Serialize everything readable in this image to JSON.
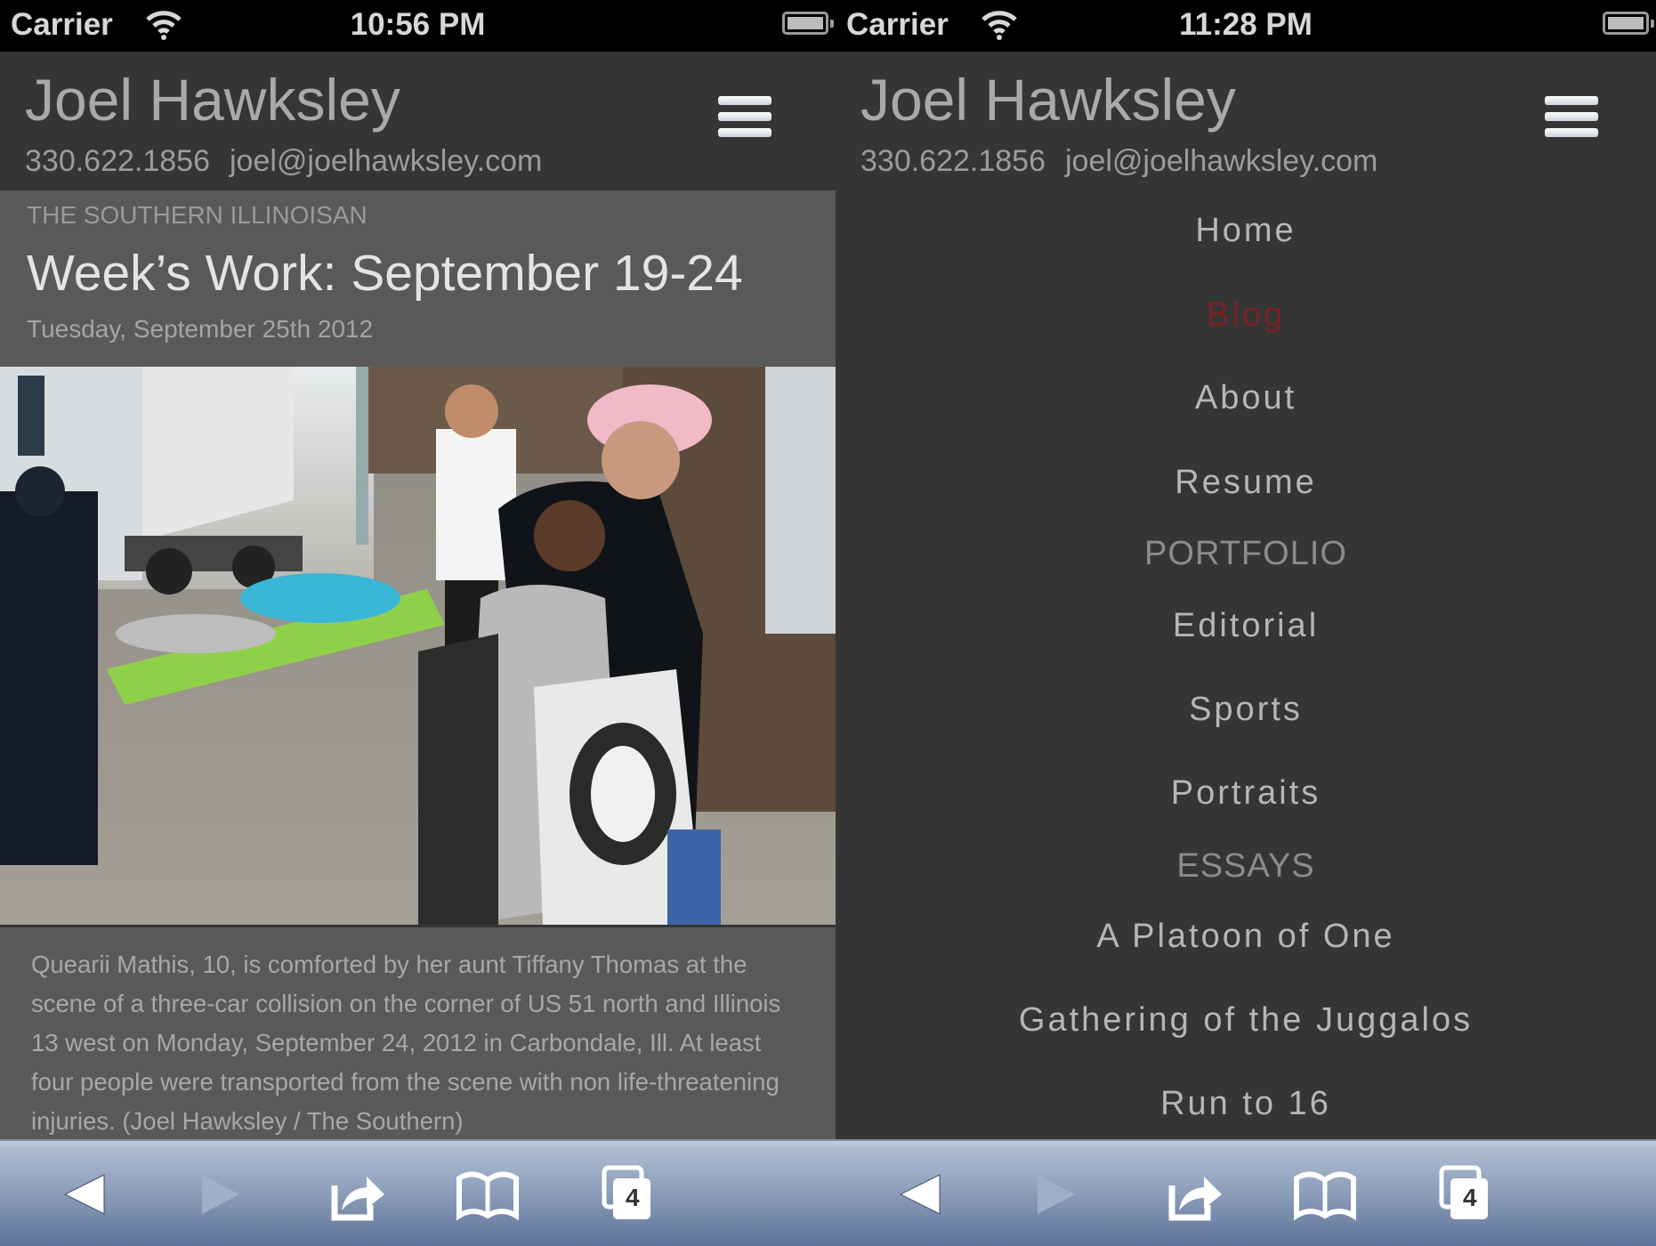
{
  "left_screen": {
    "status_bar": {
      "carrier": "Carrier",
      "time": "10:56 PM",
      "wifi_icon": "wifi-icon",
      "battery_icon": "battery-icon"
    },
    "header": {
      "site_name": "Joel Hawksley",
      "phone": "330.622.1856",
      "email": "joel@joelhawksley.com",
      "menu_icon": "hamburger-menu-icon"
    },
    "post": {
      "kicker": "THE SOUTHERN ILLINOISAN",
      "title": "Week’s Work: September 19-24",
      "date": "Tuesday, September 25th 2012",
      "photo_alt": "Girl comforted by her aunt at scene of car collision while paramedics carry patient on stretcher",
      "caption": "Quearii Mathis, 10, is comforted by her aunt Tiffany Thomas at the scene of a three-car collision on the corner of US 51 north and Illinois 13 west on Monday, September 24, 2012 in Carbondale, Ill. At least four people were transported from the scene with non life-threatening injuries. (Joel Hawksley / The Southern)"
    },
    "toolbar": {
      "back_icon": "back-arrow-icon",
      "forward_icon": "forward-arrow-icon",
      "share_icon": "share-icon",
      "bookmarks_icon": "bookmarks-book-icon",
      "tabs_icon": "tabs-icon",
      "tabs_count": "4"
    }
  },
  "right_screen": {
    "status_bar": {
      "carrier": "Carrier",
      "time": "11:28 PM",
      "wifi_icon": "wifi-icon",
      "battery_icon": "battery-icon"
    },
    "header": {
      "site_name": "Joel Hawksley",
      "phone": "330.622.1856",
      "email": "joel@joelhawksley.com",
      "menu_icon": "hamburger-menu-icon"
    },
    "menu": {
      "items": [
        {
          "label": "Home",
          "type": "link"
        },
        {
          "label": "Blog",
          "type": "link",
          "active": true
        },
        {
          "label": "About",
          "type": "link"
        },
        {
          "label": "Resume",
          "type": "link"
        },
        {
          "label": "PORTFOLIO",
          "type": "section"
        },
        {
          "label": "Editorial",
          "type": "link"
        },
        {
          "label": "Sports",
          "type": "link"
        },
        {
          "label": "Portraits",
          "type": "link"
        },
        {
          "label": "ESSAYS",
          "type": "section"
        },
        {
          "label": "A Platoon of One",
          "type": "link"
        },
        {
          "label": "Gathering of the Juggalos",
          "type": "link"
        },
        {
          "label": "Run to 16",
          "type": "link"
        }
      ]
    },
    "toolbar": {
      "back_icon": "back-arrow-icon",
      "forward_icon": "forward-arrow-icon",
      "share_icon": "share-icon",
      "bookmarks_icon": "bookmarks-book-icon",
      "tabs_icon": "tabs-icon",
      "tabs_count": "4"
    }
  },
  "colors": {
    "page_bg": "#353535",
    "article_bg": "#595959",
    "active_link": "#7a2222",
    "toolbar_top": "#b3c1d5",
    "toolbar_bottom": "#5b7197"
  }
}
